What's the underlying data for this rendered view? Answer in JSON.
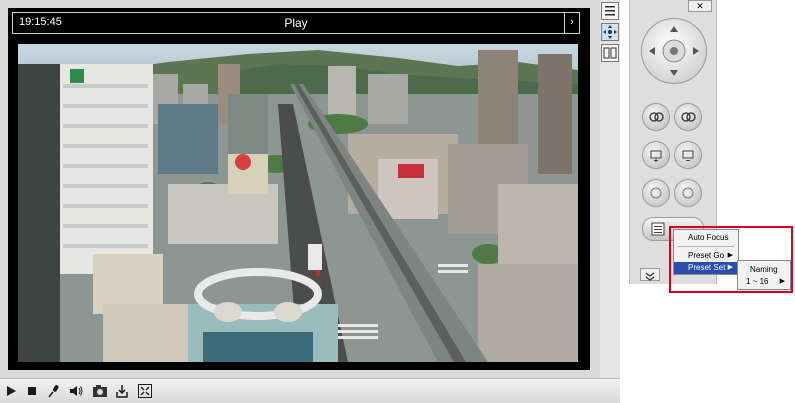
{
  "video": {
    "time": "19:15:45",
    "mode": "Play",
    "arrow": "›"
  },
  "toolbar": {
    "icons": [
      "play-icon",
      "stop-icon",
      "microphone-icon",
      "speaker-icon",
      "snapshot-icon",
      "record-icon",
      "fullscreen-icon"
    ]
  },
  "side": {
    "icons": [
      "list-icon",
      "ptz-icon",
      "io-icon"
    ]
  },
  "ptz": {
    "close": "✕"
  },
  "menu": {
    "items": [
      {
        "label": "Auto Focus",
        "has_sub": false,
        "selected": false
      },
      {
        "label": "Preset Go",
        "has_sub": true,
        "selected": false
      },
      {
        "label": "Preset Set",
        "has_sub": true,
        "selected": true
      }
    ],
    "submenu": [
      {
        "label": "Naming",
        "has_sub": false
      },
      {
        "label": "1 ~ 16",
        "has_sub": true
      }
    ],
    "arrow": "▶"
  },
  "colors": {
    "highlight": "#d9001b",
    "selected": "#2a4db0"
  }
}
